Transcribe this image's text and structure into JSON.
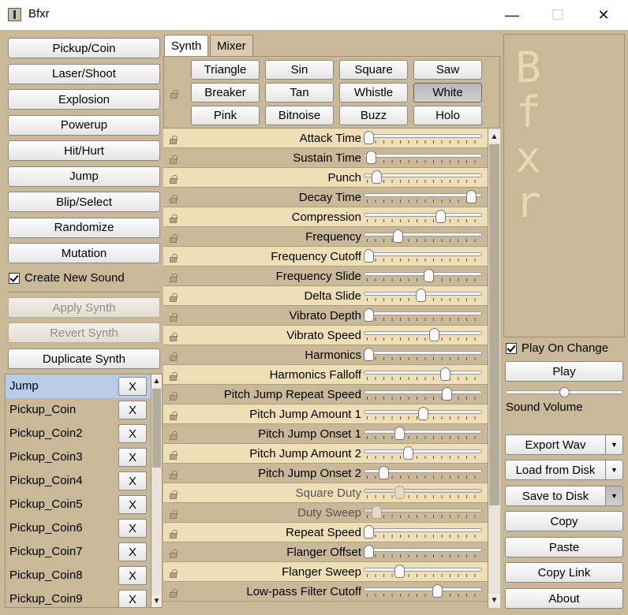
{
  "window": {
    "title": "Bfxr",
    "minimize": "—",
    "maximize": "☐",
    "close": "✕"
  },
  "generators": [
    "Pickup/Coin",
    "Laser/Shoot",
    "Explosion",
    "Powerup",
    "Hit/Hurt",
    "Jump",
    "Blip/Select",
    "Randomize",
    "Mutation"
  ],
  "create_new_sound": "Create New Sound",
  "synth_actions": {
    "apply": "Apply Synth",
    "revert": "Revert Synth",
    "duplicate": "Duplicate Synth"
  },
  "sound_list": {
    "selected_index": 0,
    "remove_label": "X",
    "items": [
      "Jump",
      "Pickup_Coin",
      "Pickup_Coin2",
      "Pickup_Coin3",
      "Pickup_Coin4",
      "Pickup_Coin5",
      "Pickup_Coin6",
      "Pickup_Coin7",
      "Pickup_Coin8",
      "Pickup_Coin9"
    ]
  },
  "tabs": {
    "synth": "Synth",
    "mixer": "Mixer",
    "active": "synth"
  },
  "waveforms": {
    "selected": "White",
    "items": [
      "Triangle",
      "Sin",
      "Square",
      "Saw",
      "Breaker",
      "Tan",
      "Whistle",
      "White",
      "Pink",
      "Bitnoise",
      "Buzz",
      "Holo"
    ]
  },
  "parameters": [
    {
      "label": "Attack Time",
      "value": 0.0,
      "disabled": false
    },
    {
      "label": "Sustain Time",
      "value": 0.02,
      "disabled": false
    },
    {
      "label": "Punch",
      "value": 0.07,
      "disabled": false
    },
    {
      "label": "Decay Time",
      "value": 0.94,
      "disabled": false
    },
    {
      "label": "Compression",
      "value": 0.66,
      "disabled": false
    },
    {
      "label": "Frequency",
      "value": 0.27,
      "disabled": false
    },
    {
      "label": "Frequency Cutoff",
      "value": 0.0,
      "disabled": false
    },
    {
      "label": "Frequency Slide",
      "value": 0.55,
      "disabled": false
    },
    {
      "label": "Delta Slide",
      "value": 0.48,
      "disabled": false
    },
    {
      "label": "Vibrato Depth",
      "value": 0.0,
      "disabled": false
    },
    {
      "label": "Vibrato Speed",
      "value": 0.6,
      "disabled": false
    },
    {
      "label": "Harmonics",
      "value": 0.0,
      "disabled": false
    },
    {
      "label": "Harmonics Falloff",
      "value": 0.7,
      "disabled": false
    },
    {
      "label": "Pitch Jump Repeat Speed",
      "value": 0.72,
      "disabled": false
    },
    {
      "label": "Pitch Jump Amount 1",
      "value": 0.5,
      "disabled": false
    },
    {
      "label": "Pitch Jump Onset 1",
      "value": 0.28,
      "disabled": false
    },
    {
      "label": "Pitch Jump Amount 2",
      "value": 0.36,
      "disabled": false
    },
    {
      "label": "Pitch Jump Onset 2",
      "value": 0.14,
      "disabled": false
    },
    {
      "label": "Square Duty",
      "value": 0.28,
      "disabled": true
    },
    {
      "label": "Duty Sweep",
      "value": 0.07,
      "disabled": true
    },
    {
      "label": "Repeat Speed",
      "value": 0.0,
      "disabled": false
    },
    {
      "label": "Flanger Offset",
      "value": 0.0,
      "disabled": false
    },
    {
      "label": "Flanger Sweep",
      "value": 0.28,
      "disabled": false
    },
    {
      "label": "Low-pass Filter Cutoff",
      "value": 0.63,
      "disabled": false
    }
  ],
  "right_panel": {
    "logo": "Bfxr",
    "play_on_change": "Play On Change",
    "play": "Play",
    "volume_label": "Sound Volume",
    "volume": 0.5,
    "export_wav": "Export Wav",
    "load_from_disk": "Load from Disk",
    "save_to_disk": "Save to Disk",
    "copy": "Copy",
    "paste": "Paste",
    "copy_link": "Copy Link",
    "about": "About"
  }
}
